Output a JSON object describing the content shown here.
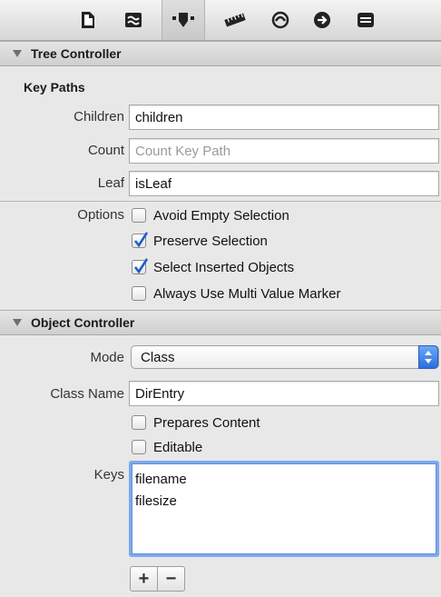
{
  "toolbar": {
    "icons": [
      "file-icon",
      "quick-help-icon",
      "attributes-icon",
      "size-ruler-icon",
      "connections-icon",
      "bindings-icon",
      "effects-icon"
    ],
    "selected": "attributes-icon"
  },
  "tree_controller": {
    "header": "Tree Controller",
    "key_paths_title": "Key Paths",
    "children_label": "Children",
    "children_value": "children",
    "count_label": "Count",
    "count_placeholder": "Count Key Path",
    "leaf_label": "Leaf",
    "leaf_value": "isLeaf",
    "options_label": "Options",
    "options": [
      {
        "label": "Avoid Empty Selection",
        "checked": false
      },
      {
        "label": "Preserve Selection",
        "checked": true
      },
      {
        "label": "Select Inserted Objects",
        "checked": true
      },
      {
        "label": "Always Use Multi Value Marker",
        "checked": false
      }
    ]
  },
  "object_controller": {
    "header": "Object Controller",
    "mode_label": "Mode",
    "mode_value": "Class",
    "class_name_label": "Class Name",
    "class_name_value": "DirEntry",
    "prepares_content": {
      "label": "Prepares Content",
      "checked": false
    },
    "editable": {
      "label": "Editable",
      "checked": false
    },
    "keys_label": "Keys",
    "keys": [
      "filename",
      "filesize"
    ],
    "add_label": "+",
    "remove_label": "−"
  },
  "colors": {
    "accent": "#2a6fe0",
    "check": "#1d5fc9",
    "panel_bg": "#e8e8e8"
  }
}
